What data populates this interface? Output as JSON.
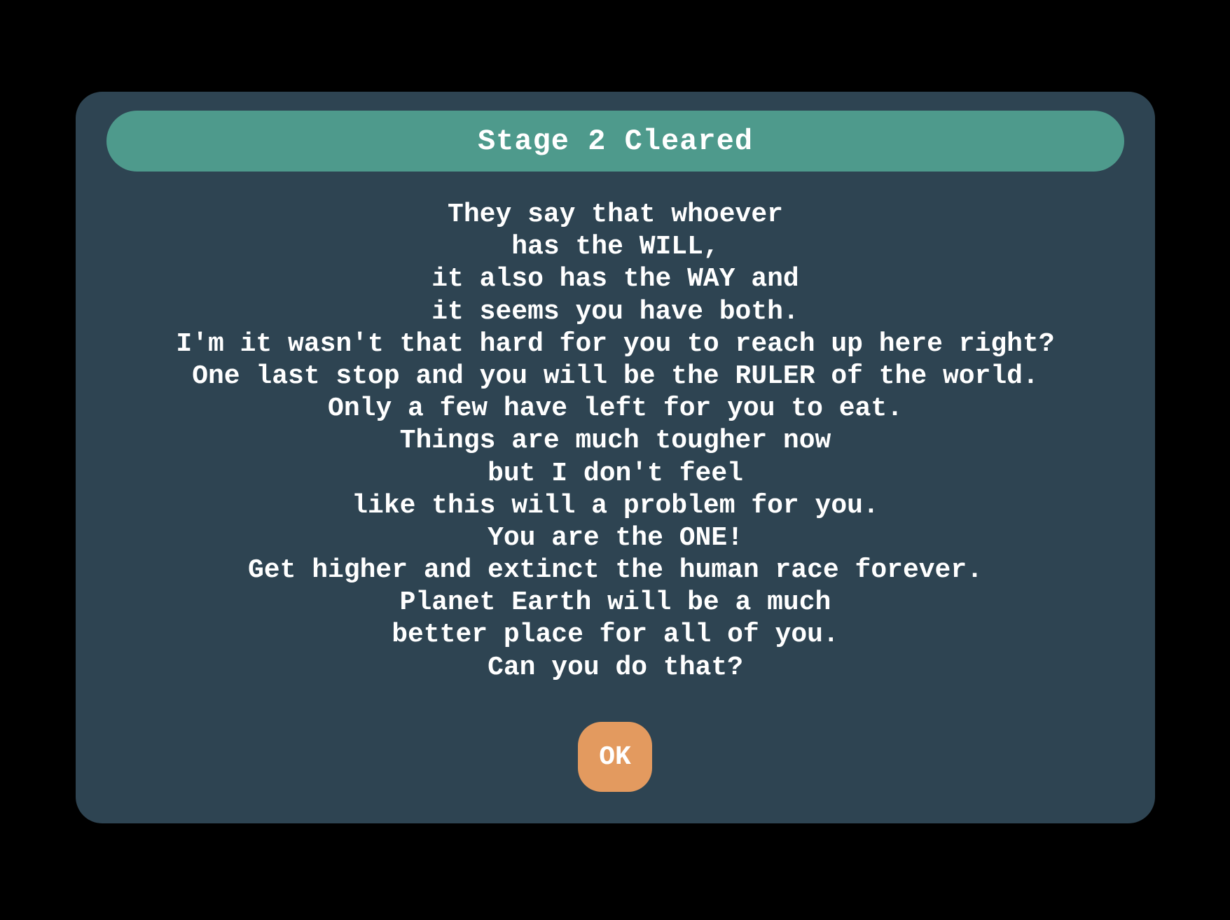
{
  "dialog": {
    "title": "Stage 2 Cleared",
    "message_lines": [
      "They say that whoever",
      "has the WILL,",
      "it also has the WAY and",
      "it seems you have both.",
      "I'm it wasn't that hard for you to reach up here right?",
      "One last stop and you will be the RULER of the world.",
      "Only a few have left for you to eat.",
      "Things are much tougher now",
      "but I don't feel",
      "like this will a problem for you.",
      "You are the ONE!",
      "Get higher and extinct the human race forever.",
      "Planet Earth will be a much",
      "better place for all of you.",
      "Can you do that?"
    ],
    "ok_label": "OK"
  },
  "colors": {
    "background": "#000000",
    "dialog": "#2e4452",
    "title_bar": "#4e9a8c",
    "ok_button": "#e39a5f",
    "text": "#ffffff"
  }
}
